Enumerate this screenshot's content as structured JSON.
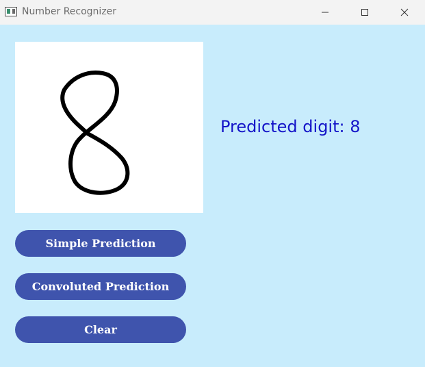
{
  "window": {
    "title": "Number Recognizer",
    "app_icon": "window-app-icon",
    "controls": [
      "minimize-icon",
      "maximize-icon",
      "close-icon"
    ]
  },
  "prediction": {
    "text": "Predicted digit: 8"
  },
  "buttons": {
    "simple": "Simple Prediction",
    "convoluted": "Convoluted Prediction",
    "clear": "Clear"
  },
  "colors": {
    "background": "#c8ecfc",
    "button": "#3f54ad",
    "button_text": "#ffffff",
    "prediction_text": "#1414c8",
    "canvas": "#ffffff",
    "stroke": "#000000"
  }
}
